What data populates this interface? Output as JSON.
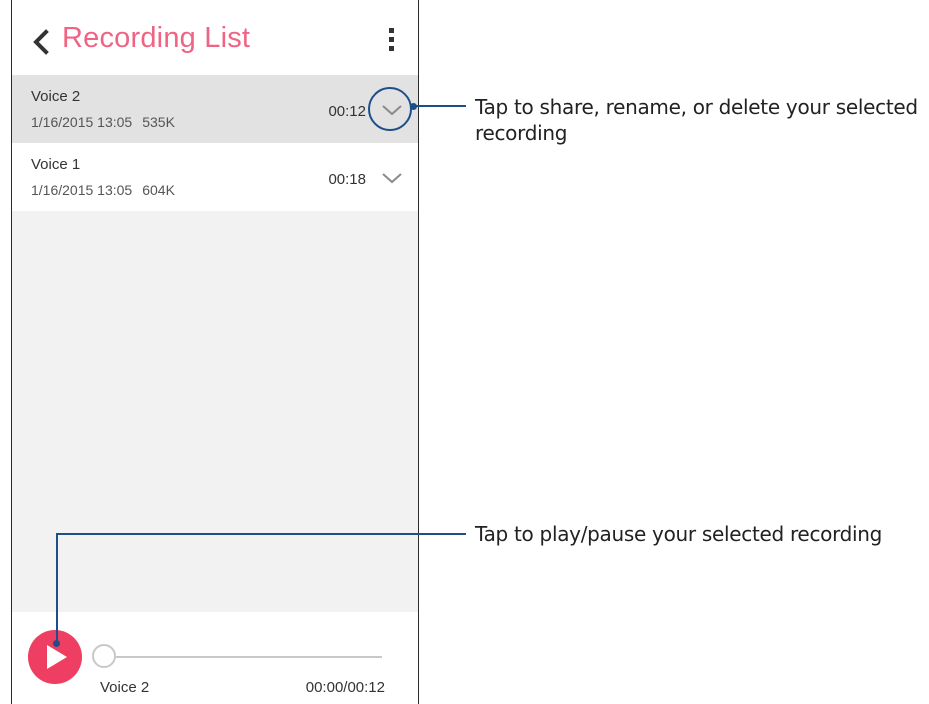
{
  "header": {
    "title": "Recording List",
    "back_icon": "chevron-left-icon",
    "menu_icon": "more-vertical-icon"
  },
  "recordings": [
    {
      "name": "Voice 2",
      "date": "1/16/2015 13:05",
      "size": "535K",
      "duration": "00:12",
      "selected": true
    },
    {
      "name": "Voice 1",
      "date": "1/16/2015 13:05",
      "size": "604K",
      "duration": "00:18",
      "selected": false
    }
  ],
  "player": {
    "track_name": "Voice 2",
    "time": "00:00/00:12",
    "progress": 0,
    "play_icon": "play-icon"
  },
  "callouts": {
    "menu_callout": "Tap to share, rename, or delete your selected recording",
    "play_callout": "Tap to play/pause your selected recording"
  },
  "colors": {
    "accent": "#ee3e62",
    "title": "#f06483",
    "callout": "#1c4f8a",
    "selected_row": "#e2e2e2"
  }
}
